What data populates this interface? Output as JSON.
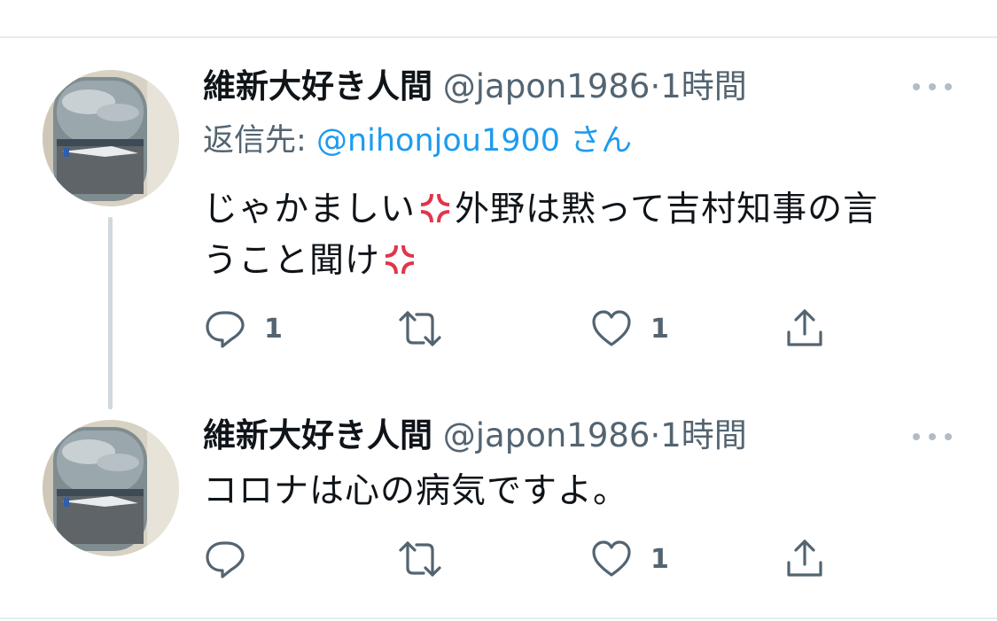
{
  "tweets": [
    {
      "author_name": "維新大好き人間",
      "handle": "@japon1986",
      "separator": "·",
      "time": "1時間",
      "reply_to_prefix": "返信先:",
      "reply_to_handle": "@nihonjou1900",
      "reply_to_suffix": "さん",
      "text_parts": [
        "じゃかましい",
        "外野は黙って吉村知事の言",
        "うこと聞け"
      ],
      "reply_count": "1",
      "retweet_count": "",
      "like_count": "1"
    },
    {
      "author_name": "維新大好き人間",
      "handle": "@japon1986",
      "separator": "·",
      "time": "1時間",
      "text": "コロナは心の病気ですよ。",
      "reply_count": "",
      "retweet_count": "",
      "like_count": "1"
    }
  ],
  "icons": {
    "reply": "reply-icon",
    "retweet": "retweet-icon",
    "like": "heart-icon",
    "share": "share-icon",
    "more": "more-icon",
    "anger_emoji": "anger-symbol-emoji"
  },
  "colors": {
    "mention": "#1d9bf0",
    "secondary_text": "#536471",
    "thread_line": "#cfd9de",
    "anger_emoji": "#e0364a"
  }
}
